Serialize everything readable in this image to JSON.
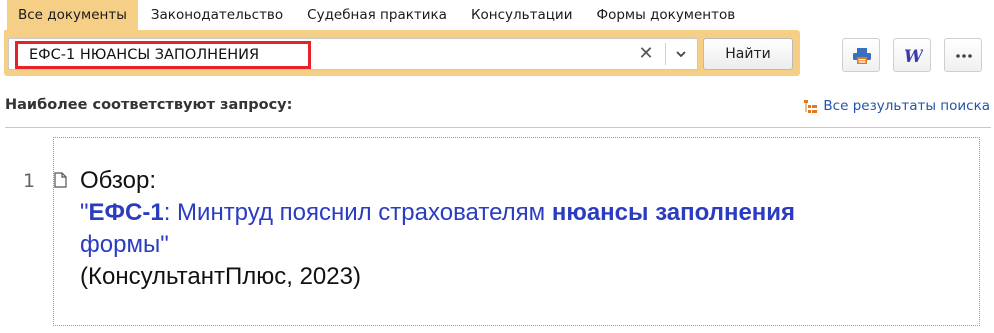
{
  "tabs": [
    {
      "label": "Все документы",
      "active": true
    },
    {
      "label": "Законодательство",
      "active": false
    },
    {
      "label": "Судебная практика",
      "active": false
    },
    {
      "label": "Консультации",
      "active": false
    },
    {
      "label": "Формы документов",
      "active": false
    }
  ],
  "search": {
    "value": "ЕФС-1 НЮАНСЫ ЗАПОЛНЕНИЯ",
    "find_label": "Найти"
  },
  "toolbar": {
    "word_letter": "W",
    "more_label": "•••"
  },
  "results": {
    "title": "Наиболее соответствуют запросу:",
    "all_results_label": "Все результаты поиска",
    "items": [
      {
        "number": "1",
        "prefix": "Обзор:",
        "title_runs": [
          {
            "text": "\"",
            "bold": false
          },
          {
            "text": "ЕФС-1",
            "bold": true
          },
          {
            "text": ": Минтруд пояснил страхователям ",
            "bold": false
          },
          {
            "text": "нюансы",
            "bold": true
          },
          {
            "text": " ",
            "bold": false
          },
          {
            "text": "заполнения",
            "bold": true
          },
          {
            "text": " формы\"",
            "bold": false
          }
        ],
        "source": "(КонсультантПлюс, 2023)"
      }
    ]
  },
  "colors": {
    "tab_active_bg": "#f6cf87",
    "search_highlight_border": "#e8222a",
    "link": "#2b3cc0",
    "accent_orange": "#e07a1a"
  }
}
